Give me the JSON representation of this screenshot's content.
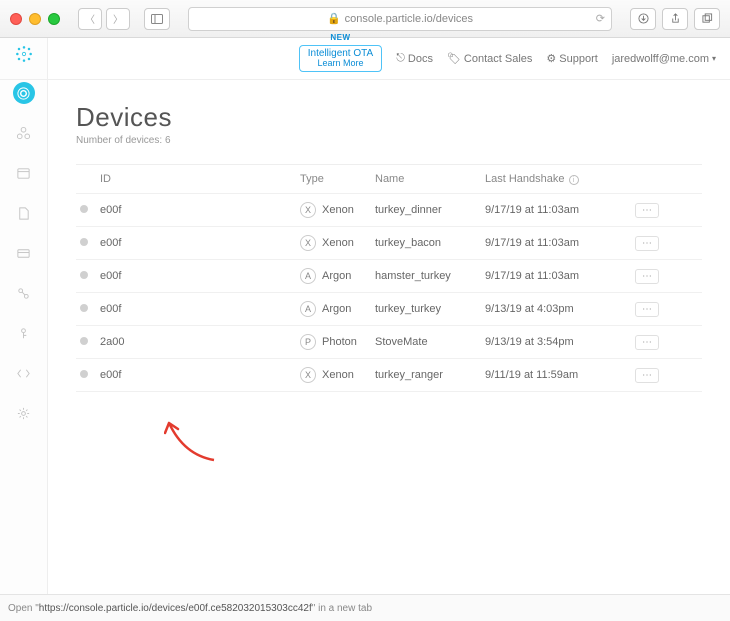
{
  "browser": {
    "address": "console.particle.io/devices",
    "status_prefix": "Open \"",
    "status_url": "https://console.particle.io/devices/e00f.ce582032015303cc42f",
    "status_suffix": "\" in a new tab"
  },
  "header": {
    "promo_tag": "NEW",
    "promo_title": "Intelligent OTA",
    "promo_learn": "Learn More",
    "docs": "Docs",
    "contact": "Contact Sales",
    "support": "Support",
    "user": "jaredwolff@me.com"
  },
  "sidebar": {
    "brand": "Particle",
    "items": [
      {
        "name": "devices",
        "active": true
      },
      {
        "name": "products"
      },
      {
        "name": "events"
      },
      {
        "name": "sims"
      },
      {
        "name": "billing"
      },
      {
        "name": "integrations"
      },
      {
        "name": "auth"
      },
      {
        "name": "ide"
      },
      {
        "name": "settings"
      }
    ]
  },
  "page": {
    "title": "Devices",
    "sub_label": "Number of devices:",
    "sub_count": "6",
    "columns": {
      "id": "ID",
      "type": "Type",
      "name": "Name",
      "last": "Last Handshake"
    },
    "rows": [
      {
        "id": "e00f",
        "type_badge": "X",
        "type": "Xenon",
        "name": "turkey_dinner",
        "last": "9/17/19 at 11:03am"
      },
      {
        "id": "e00f",
        "type_badge": "X",
        "type": "Xenon",
        "name": "turkey_bacon",
        "last": "9/17/19 at 11:03am"
      },
      {
        "id": "e00f",
        "type_badge": "A",
        "type": "Argon",
        "name": "hamster_turkey",
        "last": "9/17/19 at 11:03am"
      },
      {
        "id": "e00f",
        "type_badge": "A",
        "type": "Argon",
        "name": "turkey_turkey",
        "last": "9/13/19 at 4:03pm"
      },
      {
        "id": "2a00",
        "type_badge": "P",
        "type": "Photon",
        "name": "StoveMate",
        "last": "9/13/19 at 3:54pm"
      },
      {
        "id": "e00f",
        "type_badge": "X",
        "type": "Xenon",
        "name": "turkey_ranger",
        "last": "9/11/19 at 11:59am"
      }
    ]
  }
}
